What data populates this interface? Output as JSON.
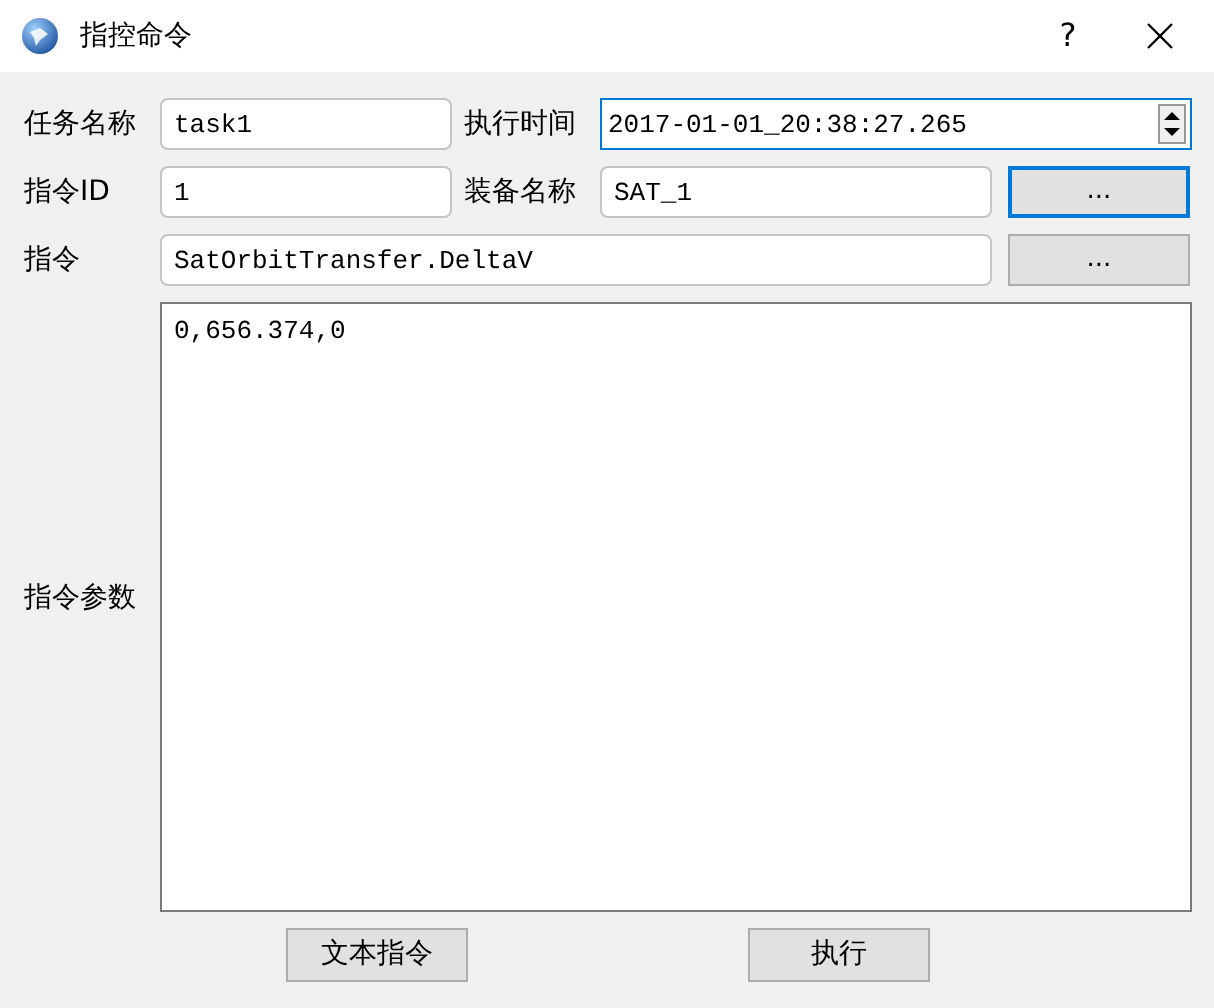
{
  "window": {
    "title": "指控命令",
    "help": "?"
  },
  "task_name": {
    "label": "任务名称",
    "value": "task1"
  },
  "exec_time": {
    "label": "执行时间",
    "value": "2017-01-01_20:38:27.265",
    "focused": true
  },
  "command_id": {
    "label": "指令ID",
    "value": "1"
  },
  "equipment_name": {
    "label": "装备名称",
    "value": "SAT_1"
  },
  "equipment_button": {
    "label": "...",
    "focused": true
  },
  "command": {
    "label": "指令",
    "value": "SatOrbitTransfer.DeltaV"
  },
  "command_button": {
    "label": "...",
    "focused": false
  },
  "params": {
    "label": "指令参数",
    "value": "0,656.374,0"
  },
  "buttons": [
    {
      "label": "文本指令"
    },
    {
      "label": "执行"
    }
  ]
}
